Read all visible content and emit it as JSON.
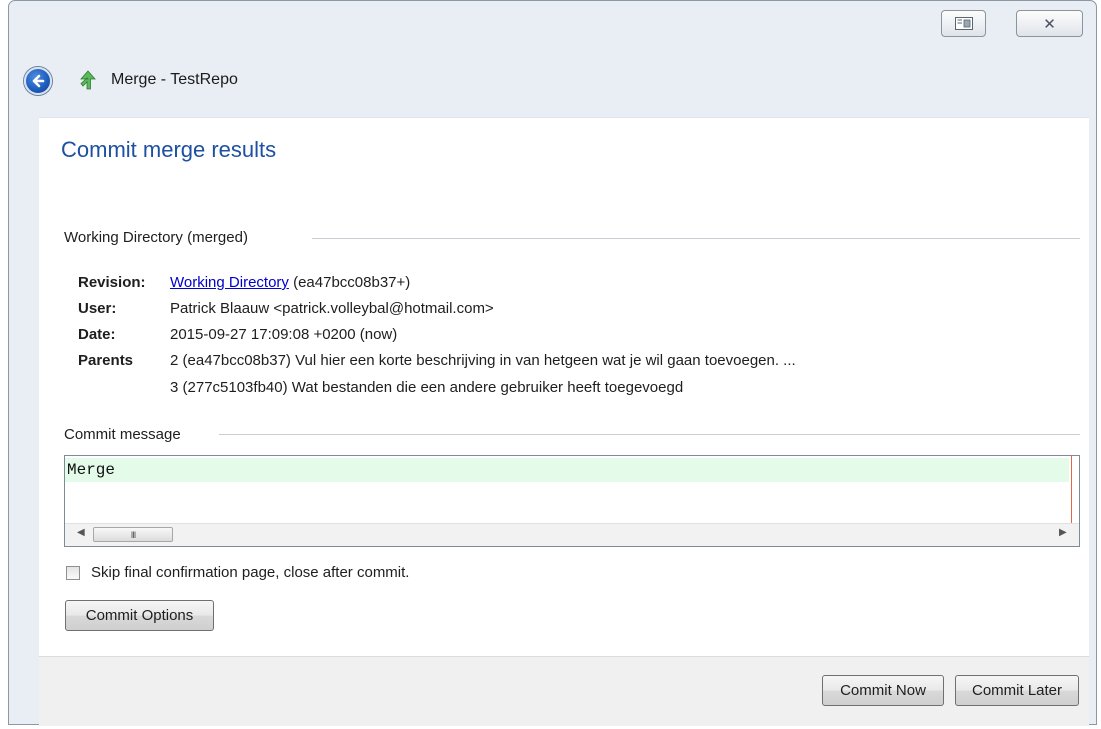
{
  "window": {
    "title": "Merge - TestRepo",
    "close_glyph": "✕"
  },
  "page": {
    "heading": "Commit merge results"
  },
  "working_dir": {
    "group_title": "Working Directory (merged)",
    "revision_label": "Revision:",
    "revision_link": "Working Directory",
    "revision_hash": "(ea47bcc08b37+)",
    "user_label": "User:",
    "user_value": "Patrick Blaauw <patrick.volleybal@hotmail.com>",
    "date_label": "Date:",
    "date_value": "2015-09-27 17:09:08 +0200 (now)",
    "parents_label": "Parents",
    "parents": [
      "2 (ea47bcc08b37) Vul hier een korte beschrijving in van hetgeen wat je wil gaan toevoegen. ...",
      "3 (277c5103fb40) Wat bestanden die een andere gebruiker heeft toegevoegd"
    ]
  },
  "commit": {
    "group_title": "Commit message",
    "message": "Merge",
    "scroll_thumb_grip": "III"
  },
  "options": {
    "skip_label": "Skip final confirmation page, close after commit.",
    "skip_checked": false,
    "commit_options_label": "Commit Options"
  },
  "footer": {
    "commit_now_label": "Commit Now",
    "commit_later_label": "Commit Later"
  },
  "colors": {
    "heading": "#1d50a2",
    "link": "#0000cc",
    "message_highlight": "#e5fbea",
    "margin_line": "#e06848"
  },
  "icons": {
    "back": "back-arrow-icon",
    "title": "merge-arrow-icon",
    "view": "restore-view-icon",
    "close": "close-icon"
  }
}
